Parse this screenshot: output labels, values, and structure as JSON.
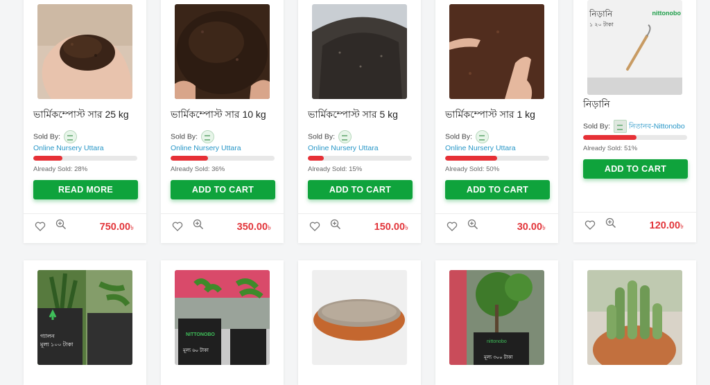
{
  "row1": [
    {
      "title": "ভার্মিকম্পোস্ট সার 25 kg",
      "sold_by": "Sold By:",
      "seller": "Online Nursery Uttara",
      "sold_pct": 28,
      "already": "Already Sold: 28%",
      "button": "READ MORE",
      "price": "750.00",
      "currency": "৳",
      "image": "soil-in-hand-image"
    },
    {
      "title": "ভার্মিকম্পোস্ট সার 10 kg",
      "sold_by": "Sold By:",
      "seller": "Online Nursery Uttara",
      "sold_pct": 36,
      "already": "Already Sold: 36%",
      "button": "ADD TO CART",
      "price": "350.00",
      "currency": "৳",
      "image": "compost-hands-image"
    },
    {
      "title": "ভার্মিকম্পোস্ট সার 5 kg",
      "sold_by": "Sold By:",
      "seller": "Online Nursery Uttara",
      "sold_pct": 15,
      "already": "Already Sold: 15%",
      "button": "ADD TO CART",
      "price": "150.00",
      "currency": "৳",
      "image": "compost-pile-image"
    },
    {
      "title": "ভার্মিকম্পোস্ট সার 1 kg",
      "sold_by": "Sold By:",
      "seller": "Online Nursery Uttara",
      "sold_pct": 50,
      "already": "Already Sold: 50%",
      "button": "ADD TO CART",
      "price": "30.00",
      "currency": "৳",
      "image": "compost-hand-image"
    },
    {
      "title": "নিড়ানি",
      "sold_by": "Sold By:",
      "seller": "নিতানব-Nittonobo",
      "sold_pct": 51,
      "already": "Already Sold: 51%",
      "button": "ADD TO CART",
      "price": "120.00",
      "currency": "৳",
      "image": "weeding-tool-image",
      "image_text": "নিড়ানি",
      "image_text2": "১ ২০ টাকা",
      "image_brand": "nittonobo"
    }
  ],
  "row2": [
    {
      "image": "grow-bag-plants-image",
      "caption_a": "গ্যালন",
      "caption_b": "মূল্য ১০০ টাকা"
    },
    {
      "image": "potted-saplings-image",
      "caption_a": "NITTONOBO",
      "caption_b": "মূল্য ৬০ টাকা"
    },
    {
      "image": "sand-bowl-image"
    },
    {
      "image": "tree-grow-bag-image",
      "caption_a": "nittonobo",
      "caption_b": "মূল্য ৩০০ টাকা"
    },
    {
      "image": "cactus-pot-image"
    }
  ],
  "colors": {
    "button": "#0fa33c",
    "price": "#e2363b",
    "progress": "#e63036",
    "seller": "#2796c7"
  }
}
